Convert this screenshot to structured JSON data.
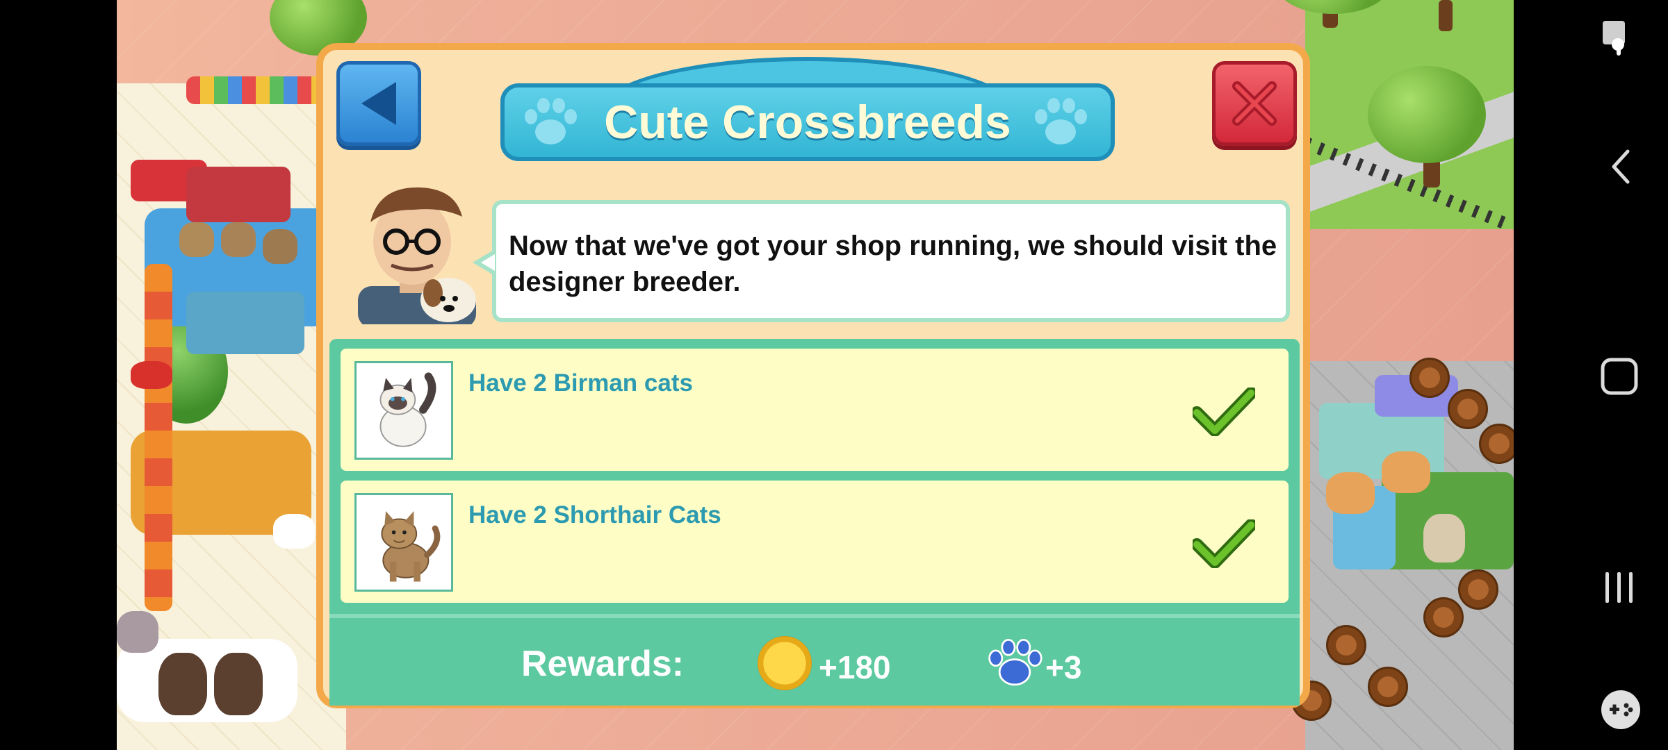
{
  "dialog": {
    "title": "Cute Crossbreeds",
    "speech": "Now that we've got your shop running, we should visit the designer breeder.",
    "tasks": [
      {
        "label": "Have 2 Birman cats",
        "completed": true,
        "icon": "birman-cat"
      },
      {
        "label": "Have 2 Shorthair Cats",
        "completed": true,
        "icon": "shorthair-cat"
      }
    ],
    "rewards": {
      "label": "Rewards:",
      "coins": "+180",
      "paws": "+3"
    },
    "buttons": {
      "back_icon": "back-arrow-icon",
      "close_icon": "close-x-icon"
    }
  },
  "colors": {
    "dialog_bg": "#fce2b3",
    "dialog_border": "#f3a94a",
    "title_banner": "#32b6d4",
    "task_bg": "#fefdc6",
    "task_text": "#2c9ab0",
    "panel_green": "#5cc9a0",
    "check_green": "#5aa51c",
    "close_red": "#d3293b",
    "back_blue": "#2b83d2"
  },
  "navbar": {
    "icons": [
      "screen-capture-icon",
      "back-chevron-icon",
      "home-square-icon",
      "recent-apps-icon",
      "game-tools-icon"
    ]
  }
}
